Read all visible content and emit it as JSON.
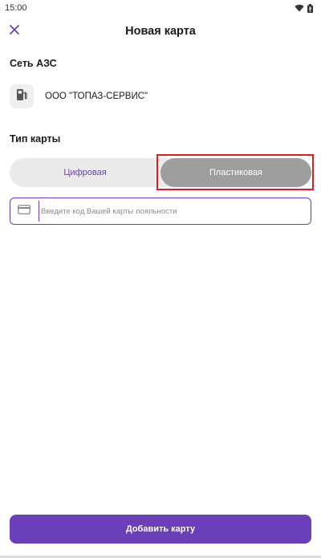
{
  "status_bar": {
    "time": "15:00"
  },
  "app_bar": {
    "title": "Новая карта"
  },
  "station_section": {
    "label": "Сеть АЗС",
    "station_name": "ООО \"ТОПАЗ-СЕРВИС\""
  },
  "card_type_section": {
    "label": "Тип карты",
    "options": [
      "Цифровая",
      "Пластиковая"
    ],
    "selected": "Пластиковая"
  },
  "card_input": {
    "value": "",
    "placeholder": "Введите код Вашей карты лояльности"
  },
  "submit_button": {
    "label": "Добавить карту"
  },
  "colors": {
    "accent": "#6a3fb8",
    "segment_selected": "#9e9e9e",
    "segment_track": "#ebebeb",
    "highlight": "#e21b1b"
  }
}
